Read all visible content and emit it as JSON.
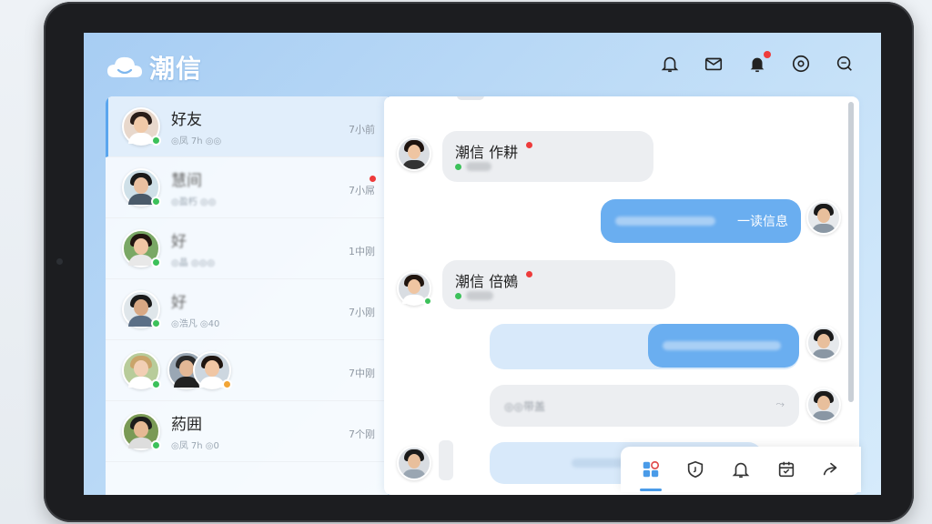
{
  "app": {
    "title": "潮信",
    "logo_icon": "cloud-icon"
  },
  "header": {
    "icons": [
      {
        "name": "bell-outline-icon",
        "badge": false
      },
      {
        "name": "mail-icon",
        "badge": false
      },
      {
        "name": "bell-filled-icon",
        "badge": true
      },
      {
        "name": "settings-icon",
        "badge": false
      },
      {
        "name": "search-chat-icon",
        "badge": false
      }
    ]
  },
  "contacts": [
    {
      "name": "好友",
      "sub": "◎凤 7h  ◎◎",
      "time": "7小前",
      "presence": "online",
      "active": true,
      "badge": false
    },
    {
      "name": "慧间",
      "sub": "◎盈朽  ◎◎",
      "time": "7小屌",
      "presence": "online",
      "active": false,
      "badge": true
    },
    {
      "name": "好",
      "sub": "◎晶  ◎◎◎",
      "time": "1中刚",
      "presence": "online",
      "active": false,
      "badge": false
    },
    {
      "name": "好",
      "sub": "◎浩凡  ◎40",
      "time": "7小刚",
      "presence": "online",
      "active": false,
      "badge": false
    },
    {
      "name": "",
      "sub": "",
      "time": "7中刚",
      "presence": "online",
      "active": false,
      "badge": false
    },
    {
      "name": "葯囲",
      "sub": "◎凤 7h  ◎0",
      "time": "7个刚",
      "presence": "online",
      "active": false,
      "badge": false
    }
  ],
  "chat": {
    "messages": [
      {
        "dir": "in",
        "title": "潮信 作耕",
        "has_dot": true,
        "sub": "◎◎"
      },
      {
        "dir": "out",
        "text": "一读信息"
      },
      {
        "dir": "in",
        "title": "潮信 倍鵺",
        "has_dot": true,
        "sub": "◎◎"
      },
      {
        "dir": "out",
        "text": ""
      },
      {
        "dir": "in-plain",
        "text": "◎◎带盖"
      },
      {
        "dir": "in-plain",
        "text": ""
      }
    ]
  },
  "toolbar": {
    "items": [
      {
        "name": "apps-icon",
        "active": true
      },
      {
        "name": "shield-icon",
        "active": false
      },
      {
        "name": "bell-icon",
        "active": false
      },
      {
        "name": "calendar-icon",
        "active": false
      },
      {
        "name": "forward-icon",
        "active": false
      }
    ]
  },
  "colors": {
    "accent": "#5aa6ee",
    "online": "#3cc15a",
    "alert": "#ee3b3b",
    "outgoing_bubble": "#6aaef0"
  }
}
